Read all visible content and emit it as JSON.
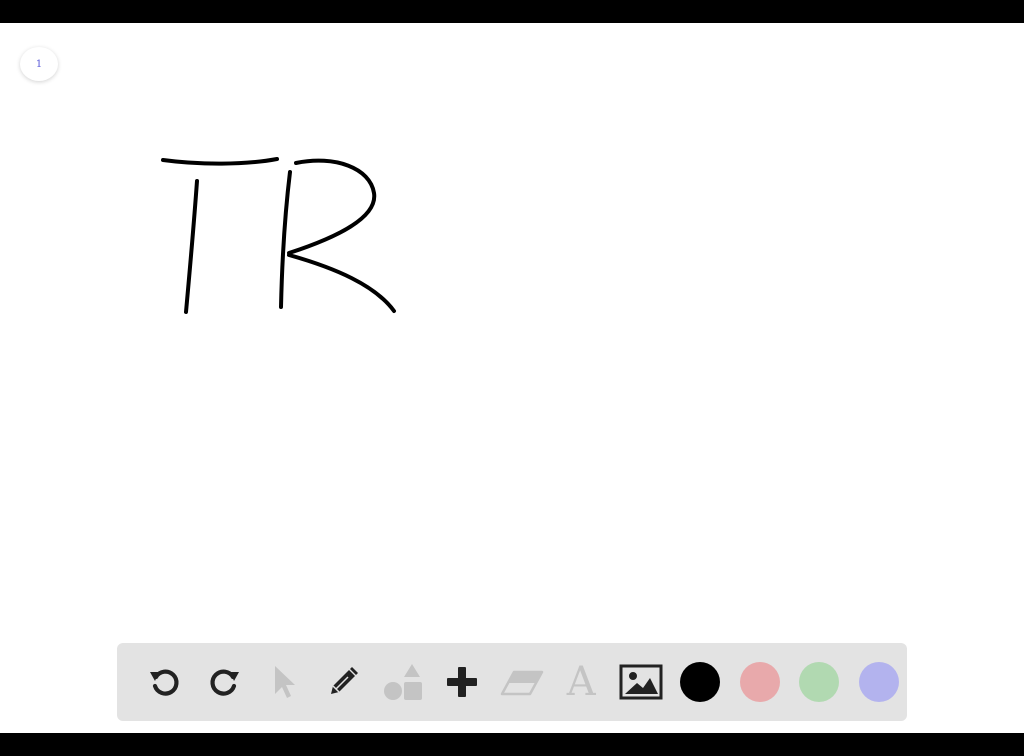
{
  "page_indicator": {
    "number": "1"
  },
  "canvas": {
    "handwriting": "TR",
    "ink_color": "#000000"
  },
  "toolbar": {
    "tools": [
      {
        "name": "undo",
        "icon": "undo-icon",
        "enabled": true
      },
      {
        "name": "redo",
        "icon": "redo-icon",
        "enabled": true
      },
      {
        "name": "select",
        "icon": "cursor-icon",
        "enabled": false
      },
      {
        "name": "pen",
        "icon": "pencil-icon",
        "enabled": true
      },
      {
        "name": "shapes",
        "icon": "shapes-icon",
        "enabled": false
      },
      {
        "name": "add",
        "icon": "plus-icon",
        "enabled": true
      },
      {
        "name": "eraser",
        "icon": "eraser-icon",
        "enabled": false
      },
      {
        "name": "text",
        "icon": "text-icon",
        "label": "A",
        "enabled": false
      },
      {
        "name": "image",
        "icon": "image-icon",
        "enabled": true
      }
    ],
    "colors": [
      "#000000",
      "#e8a9ab",
      "#b1d9b1",
      "#b3b3ee"
    ]
  }
}
